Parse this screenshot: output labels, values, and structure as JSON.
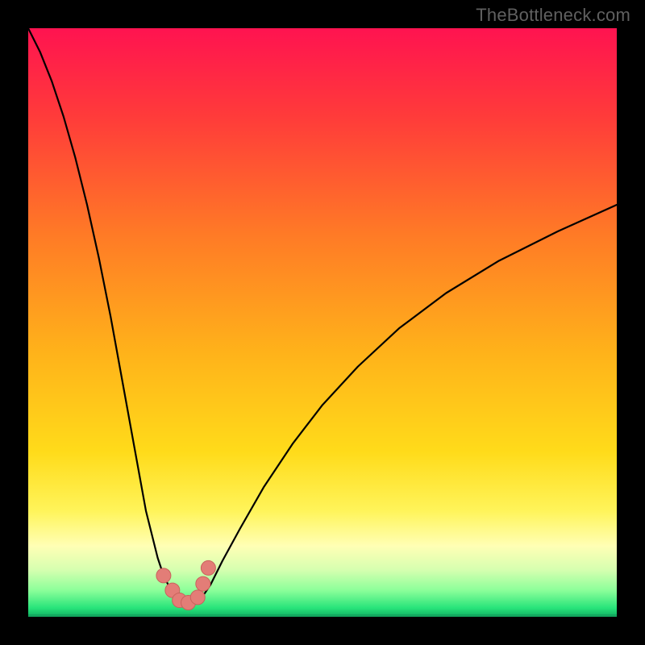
{
  "watermark": "TheBottleneck.com",
  "colors": {
    "frame": "#000000",
    "curve": "#000000",
    "markers_fill": "#e37d77",
    "markers_stroke": "#c9625c"
  },
  "chart_data": {
    "type": "line",
    "title": "",
    "xlabel": "",
    "ylabel": "",
    "xlim": [
      0,
      100
    ],
    "ylim": [
      0,
      100
    ],
    "gradient_stops": [
      {
        "offset": 0.0,
        "color": "#ff1350"
      },
      {
        "offset": 0.15,
        "color": "#ff3b3a"
      },
      {
        "offset": 0.35,
        "color": "#ff7a26"
      },
      {
        "offset": 0.55,
        "color": "#ffb21a"
      },
      {
        "offset": 0.72,
        "color": "#ffdb1a"
      },
      {
        "offset": 0.82,
        "color": "#fff45a"
      },
      {
        "offset": 0.88,
        "color": "#ffffb5"
      },
      {
        "offset": 0.92,
        "color": "#d6ffb0"
      },
      {
        "offset": 0.955,
        "color": "#8cff9a"
      },
      {
        "offset": 0.985,
        "color": "#28e47a"
      },
      {
        "offset": 1.0,
        "color": "#0fb061"
      }
    ],
    "series": [
      {
        "name": "v-curve",
        "x": [
          0,
          2,
          4,
          6,
          8,
          10,
          12,
          14,
          16,
          18,
          20,
          22,
          23,
          24,
          25,
          26,
          27,
          28,
          29,
          30,
          31,
          33,
          36,
          40,
          45,
          50,
          56,
          63,
          71,
          80,
          90,
          100
        ],
        "y": [
          100,
          96,
          91,
          85,
          78,
          70,
          61,
          51,
          40,
          29,
          18,
          10,
          7,
          5,
          3.5,
          2.6,
          2.2,
          2.3,
          2.9,
          4.0,
          5.5,
          9.5,
          15,
          22,
          29.5,
          36,
          42.5,
          49,
          55,
          60.5,
          65.5,
          70
        ]
      }
    ],
    "markers": [
      {
        "x": 23.0,
        "y": 7.0
      },
      {
        "x": 24.5,
        "y": 4.5
      },
      {
        "x": 25.7,
        "y": 2.8
      },
      {
        "x": 27.2,
        "y": 2.4
      },
      {
        "x": 28.8,
        "y": 3.3
      },
      {
        "x": 29.7,
        "y": 5.6
      },
      {
        "x": 30.6,
        "y": 8.3
      }
    ]
  }
}
